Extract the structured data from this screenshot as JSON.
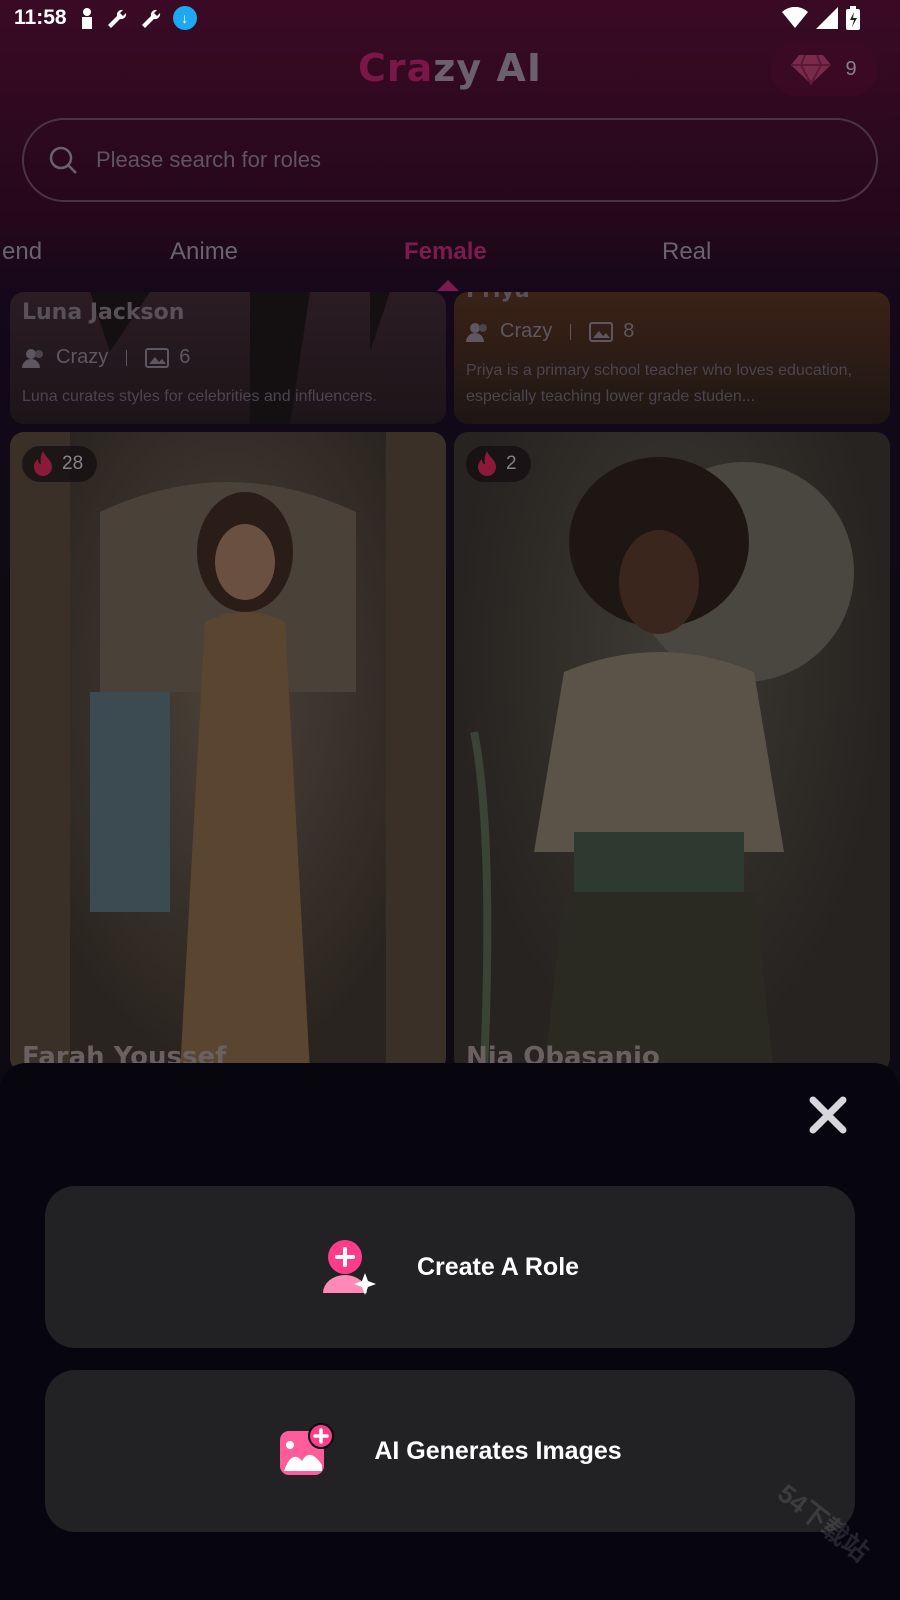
{
  "status_bar": {
    "time": "11:58"
  },
  "header": {
    "title_accent": "Cra",
    "title_rest": "zy AI",
    "gem_count": "9"
  },
  "search": {
    "placeholder": "Please search for roles"
  },
  "tabs": [
    {
      "label": "end"
    },
    {
      "label": "Anime"
    },
    {
      "label": "Female",
      "active": true
    },
    {
      "label": "Real"
    }
  ],
  "cards": [
    {
      "name": "Luna Jackson",
      "author": "Crazy",
      "image_count": "6",
      "description": "Luna curates styles for celebrities and influencers."
    },
    {
      "name": "Priya",
      "author": "Crazy",
      "image_count": "8",
      "description": "Priya is a primary school teacher who loves education, especially teaching lower grade studen..."
    },
    {
      "name": "Farah Youssef",
      "hot_count": "28"
    },
    {
      "name": "Nia Obasanjo",
      "hot_count": "2"
    }
  ],
  "sheet": {
    "create_role_label": "Create A Role",
    "ai_images_label": "AI Generates Images",
    "watermark": "54下载站"
  },
  "colors": {
    "accent": "#ff3c8a",
    "sheet_bg": "#07060f",
    "button_bg": "#222124"
  }
}
